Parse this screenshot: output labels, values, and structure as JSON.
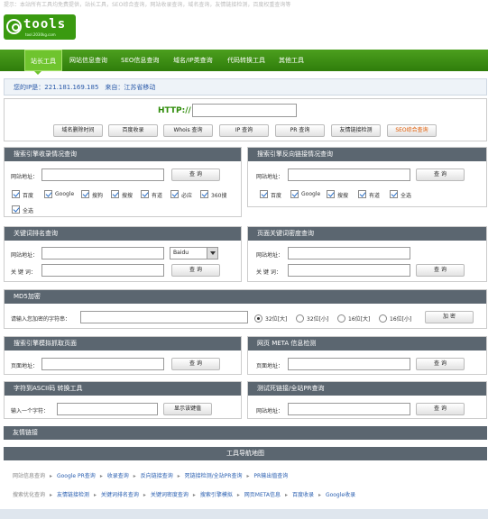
{
  "top_note": "提示：本站所有工具均免费提供，站长工具，SEO综合查询，网站收录查询，域名查询，友情链接检测，百度权重查询等",
  "logo": {
    "word": "tools",
    "sub": "tool.2030kg.com"
  },
  "nav": {
    "items": [
      "站长工具",
      "网站信息查询",
      "SEO信息查询",
      "域名/IP类查询",
      "代码转换工具",
      "其他工具"
    ]
  },
  "ip_bar": "您的IP是：221.181.169.185　来自：江苏省移动",
  "http": {
    "label": "HTTP://",
    "buttons": [
      "域名删除时间",
      "百度收录",
      "Whois 查询",
      "IP 查询",
      "PR 查询",
      "友情链接检测",
      "SEO综合查询"
    ]
  },
  "panels": {
    "index_query": {
      "title": "搜索引擎收录情况查询",
      "url_label": "网站地址：",
      "button": "查 询",
      "checks": [
        "百度",
        "Google",
        "搜狗",
        "搜搜",
        "有道",
        "必应",
        "360搜",
        "全选"
      ]
    },
    "backlink_query": {
      "title": "搜索引擎反向链接情况查询",
      "url_label": "网站地址：",
      "button": "查 询",
      "checks": [
        "百度",
        "Google",
        "搜搜",
        "有道",
        "全选"
      ]
    },
    "keyword_rank": {
      "title": "关键词排名查询",
      "url_label": "网站地址：",
      "kw_label": "关 键 词：",
      "engine": "Baidu",
      "button": "查 询"
    },
    "keyword_density": {
      "title": "页面关键词密度查询",
      "url_label": "网站地址：",
      "kw_label": "关 键 词：",
      "button": "查 询"
    },
    "md5": {
      "title": "MD5加密",
      "label": "请输入您加密的字符串：",
      "options": [
        "32位[大]",
        "32位[小]",
        "16位[大]",
        "16位[小]"
      ],
      "button": "加 密"
    },
    "spider": {
      "title": "搜索引擎模拟抓取页面",
      "url_label": "页面地址：",
      "button": "查 询"
    },
    "meta": {
      "title": "网页 META 信息检测",
      "url_label": "页面地址：",
      "button": "查 询"
    },
    "ascii": {
      "title": "字符到ASCII码 转换工具",
      "label": "输入一个字符：",
      "button": "显示该键值"
    },
    "deadlink": {
      "title": "测试死链接/全站PR查询",
      "url_label": "网站地址：",
      "button": "查 询"
    }
  },
  "friend_links": "友情链接",
  "map": {
    "title": "工具导航地图",
    "row1": [
      "网站信息查询",
      "Google PR查询",
      "收录查询",
      "反向链接查询",
      "死链接检测/全站PR查询",
      "PR输出值查询"
    ],
    "row2": [
      "搜索优化查询",
      "友情链接检测",
      "关键词排名查询",
      "关键词密度查询",
      "搜索引擎模拟",
      "网页META信息",
      "百度收录",
      "Google收录"
    ]
  }
}
